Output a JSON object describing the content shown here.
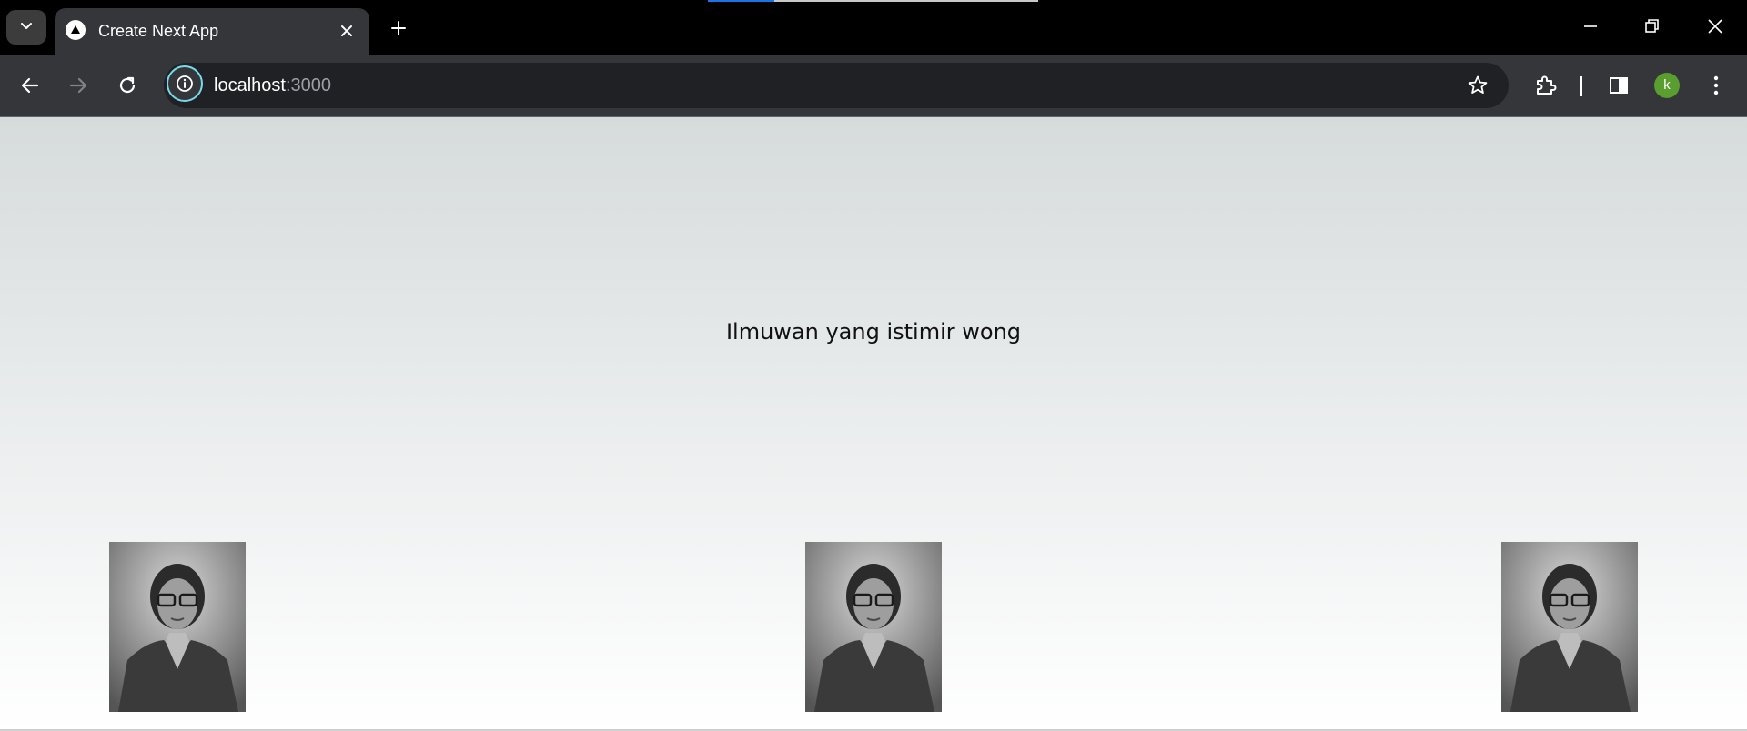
{
  "browser": {
    "tab": {
      "title": "Create Next App"
    },
    "address": {
      "host": "localhost",
      "port": ":3000"
    },
    "profile_initial": "k",
    "loading_progress": 0.2
  },
  "page": {
    "headline": "Ilmuwan yang istimir wong",
    "photos": [
      {
        "alt": "portrait photo"
      },
      {
        "alt": "portrait photo"
      },
      {
        "alt": "portrait photo"
      }
    ]
  },
  "colors": {
    "tabstrip": "#000000",
    "toolbar": "#35363a",
    "omnibox": "#202124",
    "site_info_ring": "#78d9ec",
    "avatar": "#5a9e2f",
    "loading_fill": "#1a73e8"
  },
  "icons": [
    "chevron-down-icon",
    "nextjs-favicon-icon",
    "close-icon",
    "plus-icon",
    "minimize-icon",
    "restore-icon",
    "close-window-icon",
    "back-arrow-icon",
    "forward-arrow-icon",
    "reload-icon",
    "info-icon",
    "star-icon",
    "extensions-icon",
    "side-panel-icon",
    "kebab-menu-icon"
  ]
}
